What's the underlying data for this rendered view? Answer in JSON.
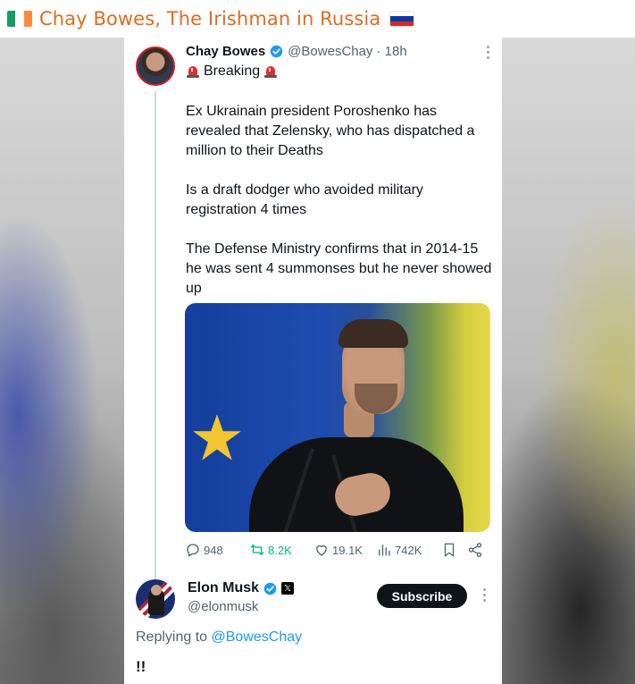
{
  "header": {
    "title": "Chay Bowes, The Irishman in Russia",
    "left_flag_icon": "ireland-flag-icon",
    "right_flag_icon": "russia-flag-icon"
  },
  "tweet": {
    "author_name": "Chay Bowes",
    "author_handle": "@BowesChay",
    "time": "· 18h",
    "breaking": "Breaking",
    "paragraphs": [
      "Ex Ukrainain president Poroshenko has revealed that Zelensky, who has dispatched a million to their Deaths",
      "Is a draft dodger who avoided military registration 4 times",
      "The Defense Ministry confirms that in 2014-15 he was sent 4 summonses but he never showed up"
    ],
    "counts": {
      "replies": "948",
      "retweets": "8.2K",
      "likes": "19.1K",
      "views": "742K"
    }
  },
  "reply": {
    "author_name": "Elon Musk",
    "author_handle": "@elonmusk",
    "subscribe_label": "Subscribe",
    "replying_to_prefix": "Replying to",
    "replying_to_handle": "@BowesChay",
    "text": "!!"
  },
  "colors": {
    "header_title": "#e06b1f",
    "verified": "#1d9bf0",
    "retweet": "#00ba7c",
    "mention": "#1d9bf0"
  }
}
